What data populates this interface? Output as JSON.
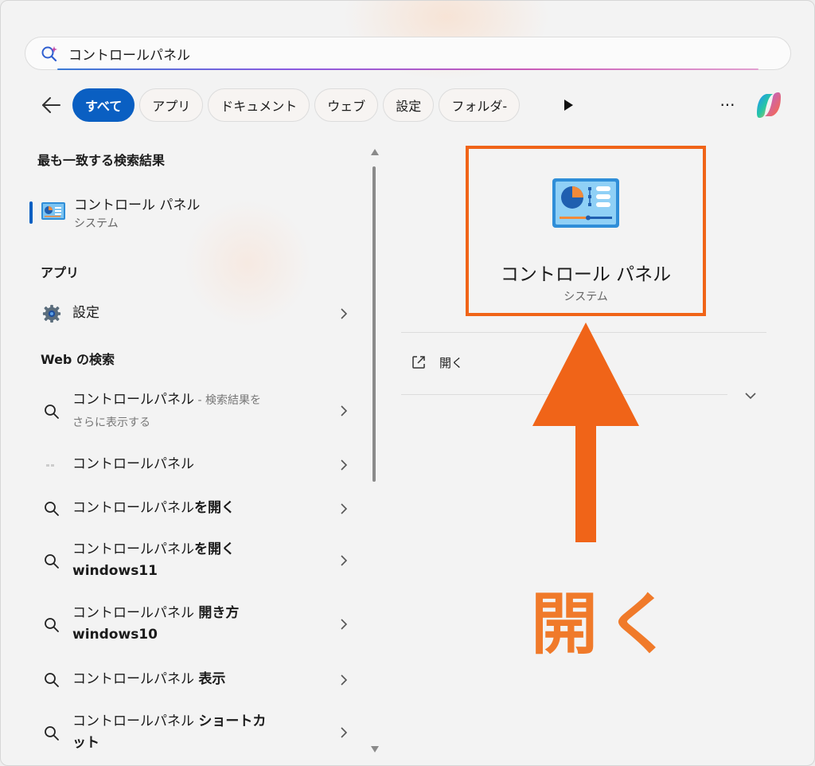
{
  "search": {
    "query": "コントロールパネル"
  },
  "filters": {
    "chips": [
      "すべて",
      "アプリ",
      "ドキュメント",
      "ウェブ",
      "設定",
      "フォルダ-"
    ],
    "more_label": "···"
  },
  "best_match": {
    "header": "最も一致する検索結果",
    "title": "コントロール パネル",
    "subtitle": "システム"
  },
  "apps": {
    "header": "アプリ",
    "items": [
      {
        "label": "設定"
      }
    ]
  },
  "web": {
    "header": "Web の検索",
    "items": [
      {
        "main": "コントロールパネル",
        "dim": " - 検索結果を",
        "line2": "さらに表示する",
        "icon": "search-icon"
      },
      {
        "main": "コントロールパネル",
        "icon": "favicon-placeholder"
      },
      {
        "main": "コントロールパネル",
        "bold": "を開く",
        "icon": "search-icon"
      },
      {
        "main": "コントロールパネル",
        "bold": "を開く",
        "line2": "windows11",
        "icon": "search-icon"
      },
      {
        "main": "コントロールパネル ",
        "bold": "開き方",
        "line2": "windows10",
        "icon": "search-icon"
      },
      {
        "main": "コントロールパネル ",
        "bold": "表示",
        "icon": "search-icon"
      },
      {
        "main": "コントロールパネル ",
        "bold": "ショートカ",
        "line2": "ット",
        "icon": "search-icon"
      }
    ]
  },
  "detail": {
    "title": "コントロール パネル",
    "subtitle": "システム",
    "open_label": "開く"
  },
  "annotation": {
    "label": "開く",
    "color": "#f06418"
  },
  "colors": {
    "accent": "#0a5fc2",
    "highlight": "#f06418"
  }
}
